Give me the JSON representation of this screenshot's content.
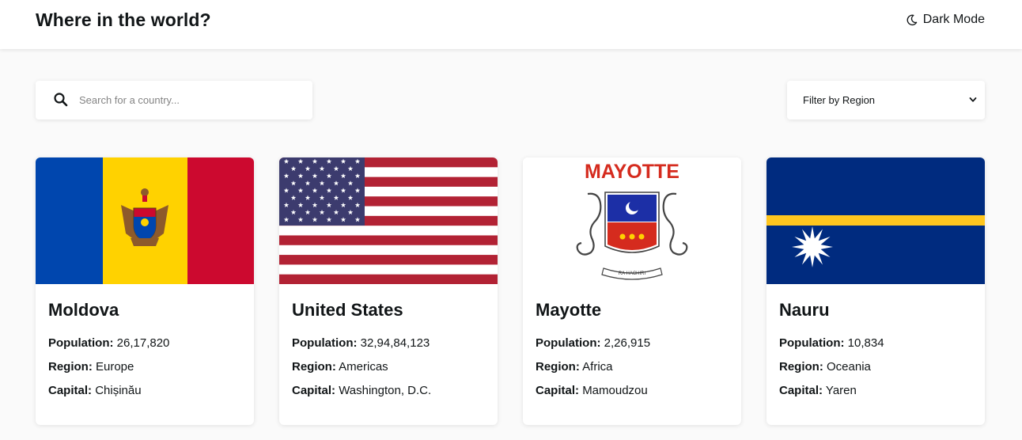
{
  "header": {
    "title": "Where in the world?",
    "mode_label": "Dark Mode",
    "mode_icon": "moon-icon"
  },
  "search": {
    "placeholder": "Search for a country...",
    "icon": "search-icon"
  },
  "filter": {
    "selected": "Filter by Region",
    "icon": "chevron-down-icon"
  },
  "labels": {
    "population": "Population:",
    "region": "Region:",
    "capital": "Capital:"
  },
  "countries": [
    {
      "name": "Moldova",
      "population": "26,17,820",
      "region": "Europe",
      "capital": "Chișinău",
      "flag": "moldova-flag"
    },
    {
      "name": "United States",
      "population": "32,94,84,123",
      "region": "Americas",
      "capital": "Washington, D.C.",
      "flag": "united-states-flag"
    },
    {
      "name": "Mayotte",
      "population": "2,26,915",
      "region": "Africa",
      "capital": "Mamoudzou",
      "flag": "mayotte-flag",
      "flag_text": "MAYOTTE",
      "flag_motto": "RA HACHIRI"
    },
    {
      "name": "Nauru",
      "population": "10,834",
      "region": "Oceania",
      "capital": "Yaren",
      "flag": "nauru-flag"
    }
  ],
  "colors": {
    "background": "#fafafa",
    "surface": "#ffffff",
    "text": "#111517",
    "placeholder": "#848484"
  }
}
